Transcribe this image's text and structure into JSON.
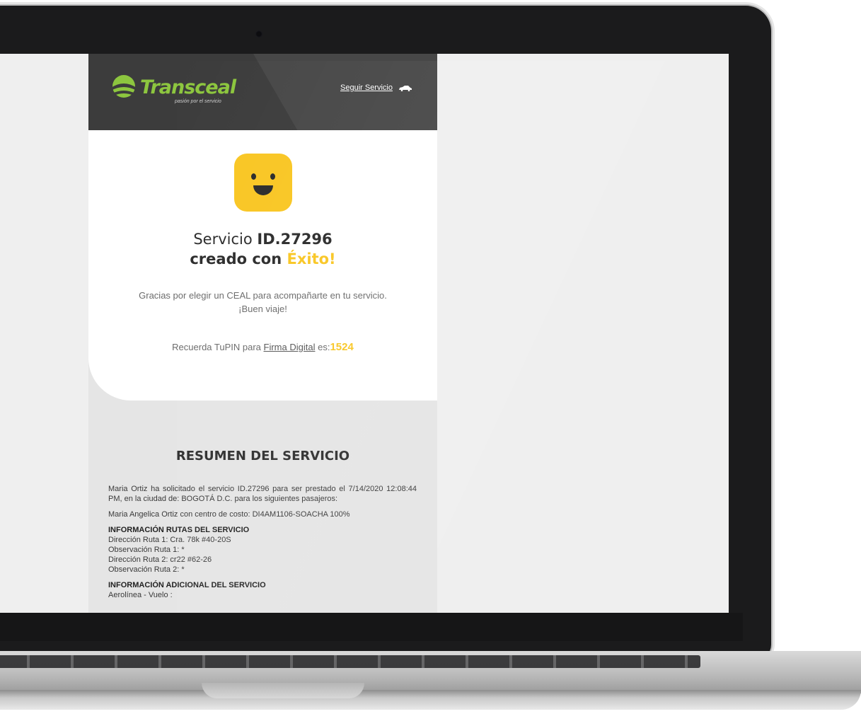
{
  "header": {
    "logo_text": "Transceal",
    "logo_tagline": "pasión por el servicio",
    "follow_link": "Seguir Servicio"
  },
  "hero": {
    "title_prefix": "Servicio ",
    "service_id": "ID.27296",
    "title_line2": "creado con ",
    "title_accent": "Éxito!",
    "thanks_line1": "Gracias por elegir un CEAL para acompañarte en tu servicio.",
    "thanks_line2": "¡Buen viaje!",
    "pin_prefix": "Recuerda TuPIN para ",
    "pin_link": "Firma Digital",
    "pin_mid": " es:",
    "pin_code": "1524"
  },
  "summary": {
    "title": "RESUMEN DEL SERVICIO",
    "paragraph": "Maria Ortiz ha solicitado el servicio ID.27296 para ser prestado el 7/14/2020 12:08:44 PM, en la ciudad de: BOGOTÁ D.C. para los siguientes pasajeros:",
    "passenger": "Maria Angelica Ortiz con centro de costo: DI4AM1106-SOACHA 100%",
    "routes_heading": "INFORMACIÓN RUTAS DEL SERVICIO",
    "routes": [
      "Dirección Ruta 1: Cra. 78k #40-20S",
      "Observación Ruta 1: *",
      "Dirección Ruta 2: cr22 #62-26",
      "Observación Ruta 2: *"
    ],
    "additional_heading": "INFORMACIÓN ADICIONAL DEL SERVICIO",
    "additional_line": "Aerolínea - Vuelo :"
  },
  "colors": {
    "accent": "#f9c623",
    "brand_green": "#8dc63f",
    "header_bg": "#3c3c3c"
  }
}
